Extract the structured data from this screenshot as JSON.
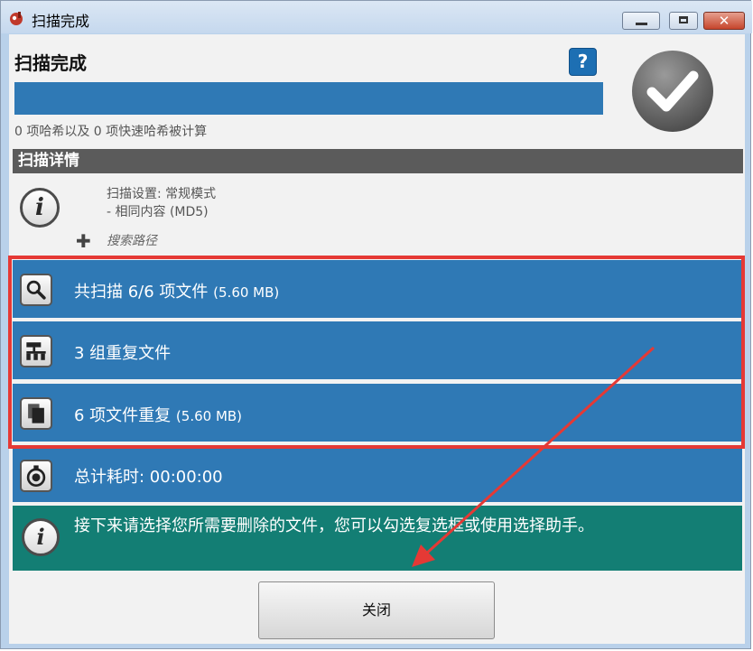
{
  "window": {
    "title": "扫描完成",
    "controls": {
      "close_symbol": "✕"
    }
  },
  "header": {
    "title": "扫描完成",
    "help_symbol": "?",
    "hash_info": "0 项哈希以及 0 项快速哈希被计算",
    "status_icon": "check-icon"
  },
  "details": {
    "bar_label": "扫描详情",
    "info_symbol": "i",
    "setting_line1": "扫描设置: 常规模式",
    "setting_line2": "- 相同内容 (MD5)",
    "expand_symbol": "✚",
    "search_path_label": "搜索路径"
  },
  "results": [
    {
      "icon": "magnifier-icon",
      "text": "共扫描 6/6 项文件",
      "size": "(5.60 MB)"
    },
    {
      "icon": "hierarchy-icon",
      "text": "3 组重复文件",
      "size": ""
    },
    {
      "icon": "files-icon",
      "text": "6 项文件重复",
      "size": "(5.60 MB)"
    }
  ],
  "timer": {
    "icon": "stopwatch-icon",
    "label": "总计耗时: 00:00:00"
  },
  "note": {
    "info_symbol": "i",
    "text": "接下来请选择您所需要删除的文件，您可以勾选复选框或使用选择助手。"
  },
  "buttons": {
    "close_label": "关闭"
  },
  "colors": {
    "accent_blue": "#2f79b5",
    "note_teal": "#137e74",
    "details_bar": "#5b5b5b",
    "highlight_red": "#e53935"
  }
}
